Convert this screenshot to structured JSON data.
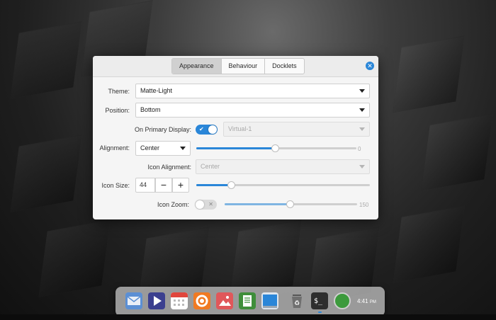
{
  "tabs": [
    {
      "label": "Appearance",
      "active": true
    },
    {
      "label": "Behaviour",
      "active": false
    },
    {
      "label": "Docklets",
      "active": false
    }
  ],
  "close_icon": "close-icon",
  "theme": {
    "label": "Theme:",
    "value": "Matte-Light"
  },
  "position": {
    "label": "Position:",
    "value": "Bottom"
  },
  "primary_display": {
    "label": "On Primary Display:",
    "toggle": "on",
    "value": "Virtual-1"
  },
  "alignment": {
    "label": "Alignment:",
    "value": "Center",
    "offset_value": "0",
    "offset_fraction": 0.49
  },
  "icon_alignment": {
    "label": "Icon Alignment:",
    "value": "Center"
  },
  "icon_size": {
    "label": "Icon Size:",
    "value": "44",
    "minus": "−",
    "plus": "+",
    "slider_fraction": 0.2
  },
  "icon_zoom": {
    "label": "Icon Zoom:",
    "toggle": "off",
    "value": "150",
    "slider_fraction": 0.49
  },
  "dock": {
    "items": [
      "mail-icon",
      "media-player-icon",
      "calendar-icon",
      "firefox-icon",
      "image-viewer-icon",
      "document-viewer-icon",
      "desktop-icon",
      "trash-icon",
      "terminal-icon",
      "status-indicator-icon"
    ],
    "time": "4:41",
    "ampm": "PM"
  },
  "colors": {
    "accent": "#2a86d8",
    "dialog_bg": "#f5f5f5"
  }
}
